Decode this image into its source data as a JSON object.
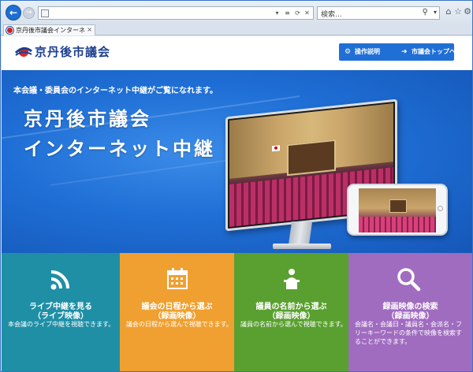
{
  "browser": {
    "search_placeholder": "検索...",
    "tab_title": "京丹後市議会インターネット...",
    "icons": [
      "back-icon",
      "forward-icon",
      "refresh-icon",
      "home-icon",
      "favorites-star-icon",
      "settings-gear-icon"
    ]
  },
  "header": {
    "logo_text": "京丹後市議会",
    "buttons": [
      {
        "label": "操作説明",
        "icon": "gear-icon"
      },
      {
        "label": "市議会トップへ",
        "icon": "chevron-right-circle-icon"
      }
    ]
  },
  "hero": {
    "tagline": "本会議・委員会のインターネット中継がご覧になれます。",
    "title_line1": "京丹後市議会",
    "title_line2": "インターネット中継"
  },
  "tiles": [
    {
      "title": "ライブ中継を見る",
      "subtitle": "（ライブ映像）",
      "desc": "本会議のライブ中継を視聴できます。",
      "icon": "broadcast-signal-icon",
      "color": "#1f8fa6"
    },
    {
      "title": "議会の日程から選ぶ",
      "subtitle": "（録画映像）",
      "desc": "議会の日程から選んで視聴できます。",
      "icon": "calendar-icon",
      "color": "#f0a030"
    },
    {
      "title": "議員の名前から選ぶ",
      "subtitle": "（録画映像）",
      "desc": "議員の名前から選んで視聴できます。",
      "icon": "speaker-podium-icon",
      "color": "#5aa030"
    },
    {
      "title": "録画映像の検索",
      "subtitle": "（録画映像）",
      "desc": "会議名・会議日・議員名・会派名・フリーキーワードの条件で映像を検索することができます。",
      "icon": "search-icon",
      "color": "#a06cc0"
    }
  ]
}
